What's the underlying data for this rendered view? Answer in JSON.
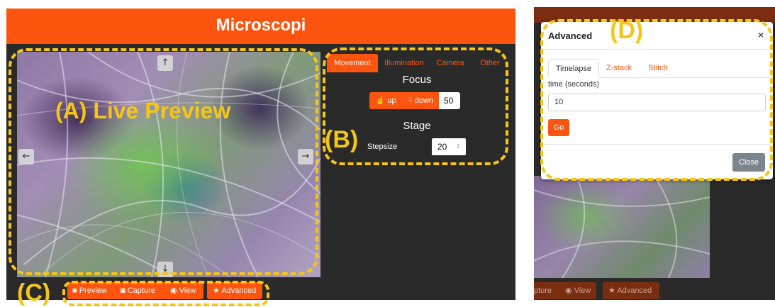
{
  "app": {
    "title": "Microscopi"
  },
  "annotations": {
    "a": "(A) Live Preview",
    "b": "(B)",
    "c": "(C)",
    "d": "(D)"
  },
  "controls": {
    "tabs": [
      {
        "label": "Movement",
        "active": true
      },
      {
        "label": "Illumination",
        "active": false
      },
      {
        "label": "Camera",
        "active": false
      },
      {
        "label": "Other",
        "active": false
      }
    ],
    "focus": {
      "title": "Focus",
      "up_label": "up",
      "down_label": "down",
      "value": "50"
    },
    "stage": {
      "title": "Stage",
      "stepsize_label": "Stepsize",
      "stepsize_value": "20"
    }
  },
  "toolbar": {
    "preview_label": "Preview",
    "capture_label": "Capture",
    "view_label": "View",
    "advanced_label": "Advanced"
  },
  "right_toolbar": {
    "capture_label": "pture",
    "view_label": "View",
    "advanced_label": "Advanced"
  },
  "modal": {
    "title": "Advanced",
    "close_x": "×",
    "tabs": [
      {
        "label": "Timelapse",
        "active": true
      },
      {
        "label": "Z-stack",
        "active": false
      },
      {
        "label": "Stitch",
        "active": false
      }
    ],
    "time_label": "time (seconds)",
    "time_value": "10",
    "go_label": "Go",
    "close_label": "Close"
  },
  "icons": {
    "up": "↑",
    "down": "↓",
    "left": "←",
    "right": "→"
  },
  "colors": {
    "accent": "#fd5510",
    "annotation": "#f5c518",
    "background": "#2a2a2a"
  }
}
